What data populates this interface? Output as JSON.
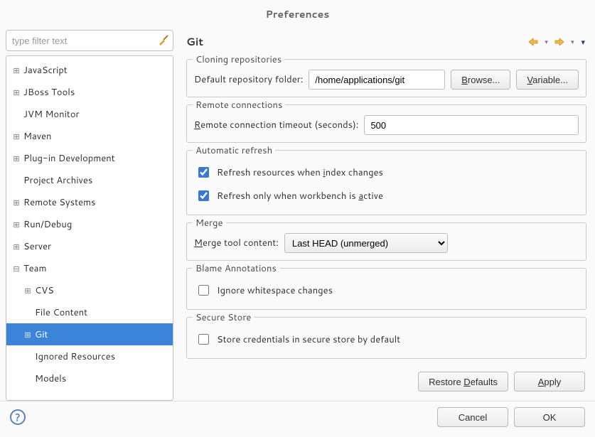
{
  "title": "Preferences",
  "filter_placeholder": "type filter text",
  "tree": [
    {
      "label": "JavaScript",
      "depth": 1,
      "tw": "plus"
    },
    {
      "label": "JBoss Tools",
      "depth": 1,
      "tw": "plus"
    },
    {
      "label": "JVM Monitor",
      "depth": 1,
      "tw": "none"
    },
    {
      "label": "Maven",
      "depth": 1,
      "tw": "plus"
    },
    {
      "label": "Plug-in Development",
      "depth": 1,
      "tw": "plus"
    },
    {
      "label": "Project Archives",
      "depth": 1,
      "tw": "none"
    },
    {
      "label": "Remote Systems",
      "depth": 1,
      "tw": "plus"
    },
    {
      "label": "Run/Debug",
      "depth": 1,
      "tw": "plus"
    },
    {
      "label": "Server",
      "depth": 1,
      "tw": "plus"
    },
    {
      "label": "Team",
      "depth": 1,
      "tw": "minus"
    },
    {
      "label": "CVS",
      "depth": 2,
      "tw": "plus"
    },
    {
      "label": "File Content",
      "depth": 2,
      "tw": "none"
    },
    {
      "label": "Git",
      "depth": 2,
      "tw": "plus",
      "selected": true
    },
    {
      "label": "Ignored Resources",
      "depth": 2,
      "tw": "none"
    },
    {
      "label": "Models",
      "depth": 2,
      "tw": "none"
    }
  ],
  "page": {
    "title": "Git",
    "cloning": {
      "title": "Cloning repositories",
      "folder_label": "Default repository folder:",
      "folder_value": "/home/applications/git",
      "browse": "Browse...",
      "variable": "Variable..."
    },
    "remote": {
      "title": "Remote connections",
      "timeout_label": "Remote connection timeout (seconds):",
      "timeout_value": "500"
    },
    "autorefresh": {
      "title": "Automatic refresh",
      "opt1": "Refresh resources when index changes",
      "opt2": "Refresh only when workbench is active",
      "opt1_checked": true,
      "opt2_checked": true
    },
    "merge": {
      "title": "Merge",
      "label": "Merge tool content:",
      "value": "Last HEAD (unmerged)"
    },
    "blame": {
      "title": "Blame Annotations",
      "opt": "Ignore whitespace changes",
      "checked": false
    },
    "secure": {
      "title": "Secure Store",
      "opt": "Store credentials in secure store by default",
      "checked": false
    },
    "restore": "Restore Defaults",
    "apply": "Apply"
  },
  "footer": {
    "cancel": "Cancel",
    "ok": "OK"
  }
}
